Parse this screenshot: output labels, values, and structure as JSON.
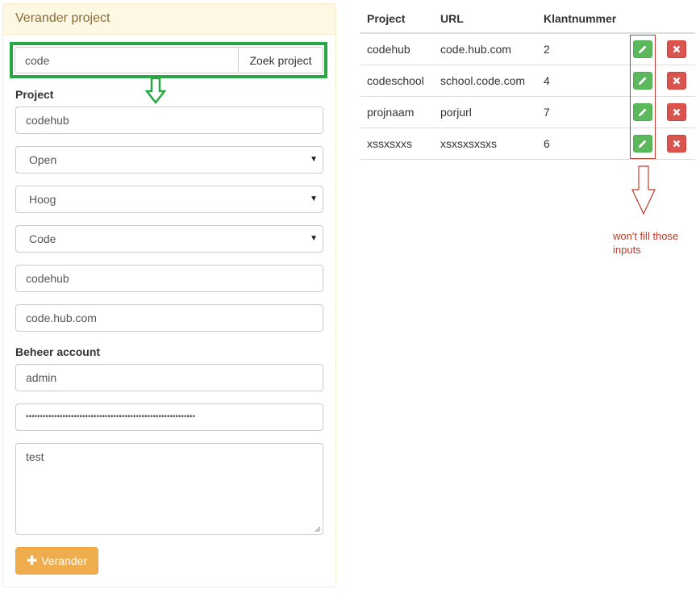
{
  "panel": {
    "title": "Verander project",
    "search": {
      "value": "code",
      "button_label": "Zoek project"
    },
    "project_label": "Project",
    "project_name": "codehub",
    "status_select": "Open",
    "priority_select": "Hoog",
    "type_select": "Code",
    "field_project": "codehub",
    "field_url": "code.hub.com",
    "account_label": "Beheer account",
    "username": "admin",
    "password": "••••••••••••••••••••••••••••••••••••••••••••••••••••••••••••",
    "notes": "test",
    "submit_label": "Verander"
  },
  "table": {
    "headers": [
      "Project",
      "URL",
      "Klantnummer"
    ],
    "rows": [
      {
        "project": "codehub",
        "url": "code.hub.com",
        "klantnummer": "2"
      },
      {
        "project": "codeschool",
        "url": "school.code.com",
        "klantnummer": "4"
      },
      {
        "project": "projnaam",
        "url": "porjurl",
        "klantnummer": "7"
      },
      {
        "project": "xssxsxxs",
        "url": "xsxsxsxsxs",
        "klantnummer": "6"
      }
    ]
  },
  "annotation": {
    "text": "won't fill those inputs"
  },
  "colors": {
    "highlight_green": "#28a745",
    "annotation_red": "#c0392b",
    "edit_button": "#5cb85c",
    "delete_button": "#d9534f",
    "submit_button": "#f0ad4e"
  },
  "icons": {
    "edit": "pencil-icon",
    "delete": "close-icon",
    "submit": "plus-icon",
    "select": "caret-down-icon"
  }
}
